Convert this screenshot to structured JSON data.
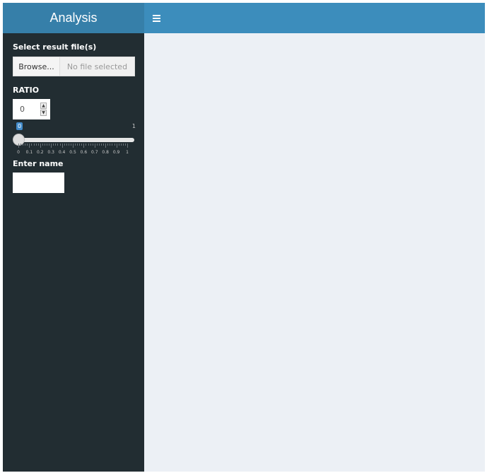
{
  "app": {
    "title": "Analysis"
  },
  "navbar": {
    "toggle_icon": "hamburger-menu-icon"
  },
  "sidebar": {
    "file_input": {
      "label": "Select result file(s)",
      "button_label": "Browse...",
      "status": "No file selected"
    },
    "ratio": {
      "label": "RATIO",
      "value": "0",
      "spin_up_icon": "spin-up-icon",
      "spin_down_icon": "spin-down-icon"
    },
    "slider": {
      "current": "0",
      "max_label": "1",
      "value": 0,
      "min": 0,
      "max": 1,
      "grid_labels": [
        "0",
        "0.1",
        "0.2",
        "0.3",
        "0.4",
        "0.5",
        "0.6",
        "0.7",
        "0.8",
        "0.9",
        "1"
      ]
    },
    "name_input": {
      "label": "Enter name",
      "value": ""
    }
  },
  "colors": {
    "header_logo": "#367fa9",
    "header_bar": "#3c8dbc",
    "sidebar": "#222d32",
    "content": "#ecf0f5",
    "slider_accent": "#428bca"
  }
}
